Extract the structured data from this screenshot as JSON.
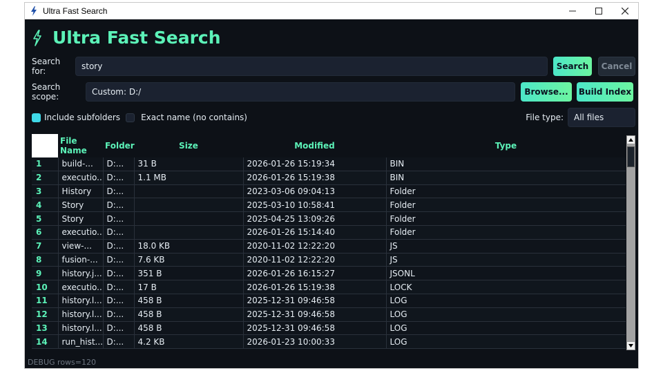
{
  "window": {
    "title": "Ultra Fast Search",
    "icon": "bolt-icon"
  },
  "header": {
    "title": "Ultra Fast Search",
    "icon": "bolt-icon",
    "accent": "#5cf2b8"
  },
  "search": {
    "label": "Search for:",
    "value": "story",
    "search_button": "Search",
    "cancel_button": "Cancel"
  },
  "scope": {
    "label": "Search scope:",
    "value": "Custom: D:/",
    "browse_button": "Browse...",
    "build_button": "Build Index"
  },
  "options": {
    "include_subfolders": {
      "label": "Include subfolders",
      "checked": true
    },
    "exact_name": {
      "label": "Exact name (no contains)",
      "checked": false
    },
    "file_type_label": "File type:",
    "file_type_value": "All files"
  },
  "table": {
    "columns": [
      "File Name",
      "Folder",
      "Size",
      "Modified",
      "Type"
    ],
    "rows": [
      [
        "1",
        "build-...",
        "D:...",
        "31 B",
        "2026-01-26 15:19:34",
        "BIN"
      ],
      [
        "2",
        "executio...",
        "D:...",
        "1.1 MB",
        "2026-01-26 15:19:38",
        "BIN"
      ],
      [
        "3",
        "History",
        "D:...",
        "",
        "2023-03-06 09:04:13",
        "Folder"
      ],
      [
        "4",
        "Story",
        "D:...",
        "",
        "2025-03-10 10:58:41",
        "Folder"
      ],
      [
        "5",
        "Story",
        "D:...",
        "",
        "2025-04-25 13:09:26",
        "Folder"
      ],
      [
        "6",
        "executio...",
        "D:...",
        "",
        "2026-01-26 15:14:40",
        "Folder"
      ],
      [
        "7",
        "view-...",
        "D:...",
        "18.0 KB",
        "2020-11-02 12:22:20",
        "JS"
      ],
      [
        "8",
        "fusion-...",
        "D:...",
        "7.6 KB",
        "2020-11-02 12:22:20",
        "JS"
      ],
      [
        "9",
        "history.j...",
        "D:...",
        "351 B",
        "2026-01-26 16:15:27",
        "JSONL"
      ],
      [
        "10",
        "executio...",
        "D:...",
        "17 B",
        "2026-01-26 15:19:38",
        "LOCK"
      ],
      [
        "11",
        "history.l...",
        "D:...",
        "458 B",
        "2025-12-31 09:46:58",
        "LOG"
      ],
      [
        "12",
        "history.l...",
        "D:...",
        "458 B",
        "2025-12-31 09:46:58",
        "LOG"
      ],
      [
        "13",
        "history.l...",
        "D:...",
        "458 B",
        "2025-12-31 09:46:58",
        "LOG"
      ],
      [
        "14",
        "run_hist...",
        "D:...",
        "4.2 KB",
        "2026-01-23 10:00:33",
        "LOG"
      ]
    ]
  },
  "status": {
    "text": "DEBUG rows=120"
  }
}
